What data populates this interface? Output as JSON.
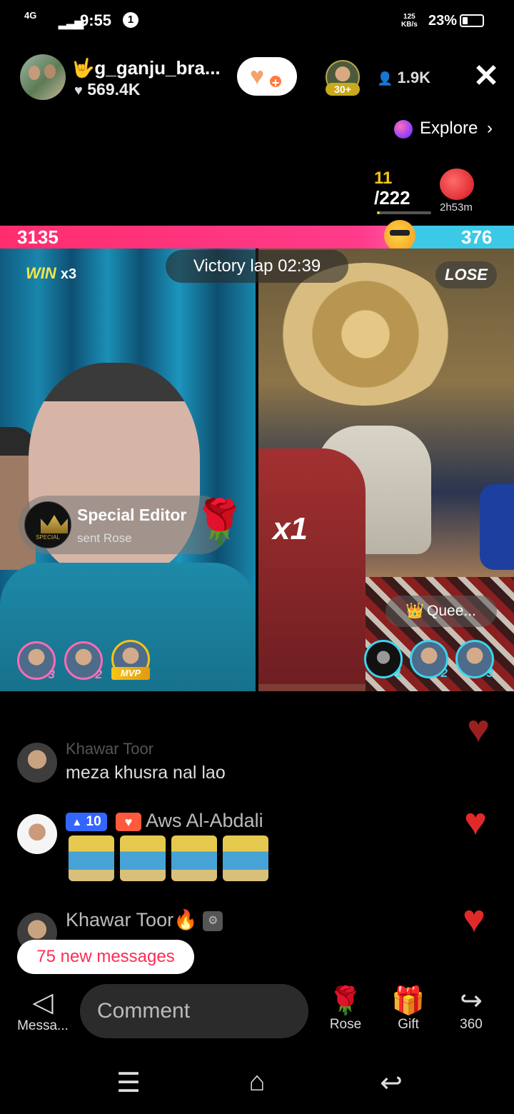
{
  "status": {
    "network": "4G",
    "time": "9:55",
    "notification": "1",
    "speed_value": "125",
    "speed_unit": "KB/s",
    "battery": "23%"
  },
  "header": {
    "host_name": "g_ganju_bra...",
    "host_likes": "569.4K",
    "viewer_badge": "30+",
    "viewer_count": "1.9K",
    "explore_label": "Explore"
  },
  "rank": {
    "current": "11",
    "total": "/222",
    "progress": 0.05,
    "timer": "2h53m"
  },
  "battle": {
    "left_score": "3135",
    "right_score": "376",
    "left_share": 0.89,
    "win_label": "WIN",
    "win_count": "x3",
    "victory_text": "Victory lap  02:39",
    "lose_label": "LOSE",
    "combo": "x1",
    "queen_label": "Quee..."
  },
  "gift_toast": {
    "sender": "Special Editor",
    "action": "sent Rose",
    "logo_text": "SPECIAL"
  },
  "left_gifters": [
    {
      "rank": "3"
    },
    {
      "rank": "2"
    },
    {
      "rank": "MVP"
    }
  ],
  "right_gifters": [
    {
      "rank": "1"
    },
    {
      "rank": "2"
    },
    {
      "rank": "3"
    }
  ],
  "chat": {
    "msg1_name": "Khawar Toor",
    "msg1_text": "meza khusra nal lao",
    "msg2_level": "10",
    "msg2_name": "Aws Al-Abdali",
    "msg3_name": "Khawar Toor",
    "new_messages": "75 new messages"
  },
  "bottom": {
    "messages_label": "Messa...",
    "comment_placeholder": "Comment",
    "rose_label": "Rose",
    "gift_label": "Gift",
    "share_label": "360"
  },
  "colors": {
    "left_team": "#ff2d6e",
    "right_team": "#3cc9e8",
    "accent": "#fe2c55",
    "gold": "#f5c518"
  }
}
